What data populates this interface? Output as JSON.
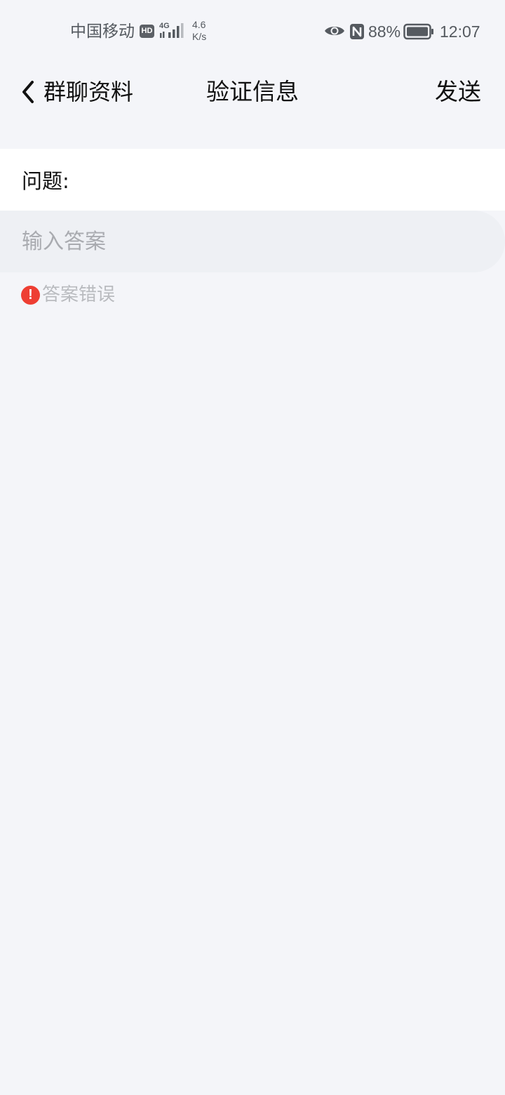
{
  "status_bar": {
    "carrier": "中国移动",
    "hd_badge": "HD",
    "network": "4G",
    "speed_value": "4.6",
    "speed_unit": "K/s",
    "battery_percent": "88%",
    "time": "12:07",
    "icons": [
      "hd-icon",
      "signal-icon",
      "eye-icon",
      "nfc-icon",
      "battery-icon"
    ]
  },
  "nav": {
    "back_label": "群聊资料",
    "title": "验证信息",
    "send_label": "发送"
  },
  "form": {
    "question_label": "问题:",
    "answer_value": "",
    "answer_placeholder": "输入答案",
    "error_icon": "!",
    "error_text": "答案错误"
  },
  "colors": {
    "background": "#f4f5f9",
    "input_background": "#eef0f4",
    "error_red": "#ee3e33",
    "placeholder_gray": "#a9abb0"
  }
}
